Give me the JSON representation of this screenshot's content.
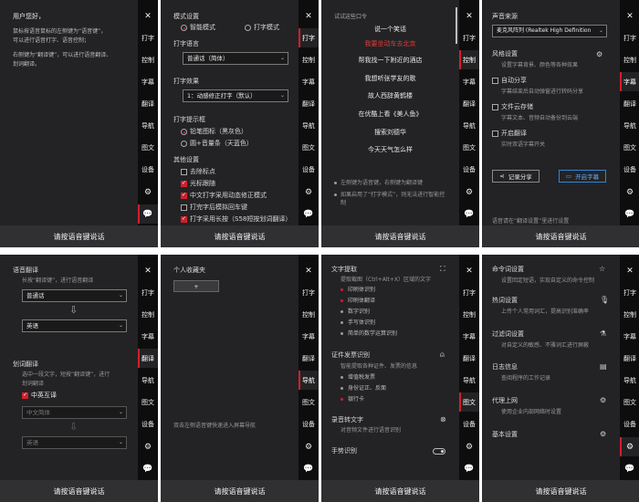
{
  "tabs": [
    "打字",
    "控制",
    "字幕",
    "翻译",
    "导航",
    "图文",
    "设备"
  ],
  "icons": {
    "gear": "gear-icon",
    "chat": "chat-icon"
  },
  "bottom_label": "请按语音键说话",
  "p1": {
    "title": "用户您好，",
    "line1": "鼠标按语音鼠标的左侧键为“语音键”，",
    "line2": "可以进行语音打字、语音控制；",
    "line3": "右侧键为“翻译键”，可以进行语音翻译、",
    "line4": "划词翻译。"
  },
  "p2": {
    "mode_title": "模式设置",
    "mode_smart": "智能模式",
    "mode_type": "打字模式",
    "lang_title": "打字语言",
    "lang_value": "普通话（简体）",
    "effect_title": "打字效果",
    "effect_value": "1：动感修正打字（默认）",
    "prompt_title": "打字提示框",
    "prompt_opt1": "铅笔图标（黑灰色）",
    "prompt_opt2": "圆+音量条（天蓝色）",
    "other_title": "其他设置",
    "opts": [
      "去除标点",
      "光标跟随",
      "中文打字采用动态修正模式",
      "打完字后模拟回车键",
      "打字采用长按（S58短按划词翻译）"
    ],
    "opts_checked": [
      false,
      true,
      true,
      false,
      true
    ]
  },
  "p3": {
    "header": "试试这些口令",
    "commands": [
      "说一个笑话",
      "我要坐动车去北京",
      "帮我找一下附近的酒店",
      "我想听张学友的歌",
      "故人西辞黄鹤楼",
      "在优酷上看《美人鱼》",
      "搜索刘德华",
      "今天天气怎么样"
    ],
    "note1": "左侧键为语音键，右侧键为翻译键",
    "note2": "如果启用了“打字模式”，则无法进行智能控制"
  },
  "p4": {
    "source_title": "声音来源",
    "source_value": "麦克风阵列 (Realtek High Definition",
    "style_title": "风格设置",
    "style_desc": "设置字幕背景、颜色等各种效果",
    "auto_share": "自动分享",
    "auto_share_desc": "字幕结束后自动弹窗进行转码分享",
    "file_save": "文件云存储",
    "file_save_desc": "字幕文本、音频自动备份到云端",
    "open_translate": "开启翻译",
    "open_translate_desc": "实时双语字幕开关",
    "btn_share": "记录分享",
    "btn_open": "开启字幕",
    "footer": "语音请在“翻译设置”里进行设置"
  },
  "p5": {
    "title": "语音翻译",
    "desc": "长按“翻译键”，进行语音翻译",
    "from": "普通话",
    "to": "英语",
    "word_title": "划词翻译",
    "word_desc1": "选中一段文字，短按“翻译键”，进行",
    "word_desc2": "划词翻译",
    "cn_en": "中英互译",
    "from2": "中文简体",
    "to2": "英语"
  },
  "p6": {
    "title": "个人收藏夹",
    "add": "+",
    "footer": "双击左侧语音键快速进入屏幕导航"
  },
  "p7": {
    "t1": "文字提取",
    "t1_desc": "提取截图（Ctrl+Alt+X）区域的文字",
    "t1_items": [
      "印刷体识别",
      "印刷体翻译",
      "数字识别",
      "手写体识别",
      "简单的数学运算识别"
    ],
    "t2": "证件发票识别",
    "t2_desc": "智能提取各种证件、发票的信息",
    "t2_items": [
      "增值税发票",
      "身份证正、反面",
      "银行卡"
    ],
    "t3": "录音转文字",
    "t3_desc": "对音频文件进行语音识别",
    "t4": "手势识别"
  },
  "p8": {
    "items": [
      {
        "title": "命令词设置",
        "desc1": "设置回定短语，实现自定义的命令控制",
        "desc2": ""
      },
      {
        "title": "热词设置",
        "desc1": "上传个人常用词汇，提高识别准确率",
        "desc2": ""
      },
      {
        "title": "过滤词设置",
        "desc1": "对自定义的敏感、不雅词汇进行屏蔽",
        "desc2": ""
      },
      {
        "title": "日志信息",
        "desc1": "查阅程序的工作记录",
        "desc2": ""
      },
      {
        "title": "代理上网",
        "desc1": "使用企业内部网络时设置",
        "desc2": ""
      },
      {
        "title": "基本设置",
        "desc1": "",
        "desc2": ""
      }
    ]
  },
  "accent": "#d21f2b",
  "blue": "#2f86d9"
}
